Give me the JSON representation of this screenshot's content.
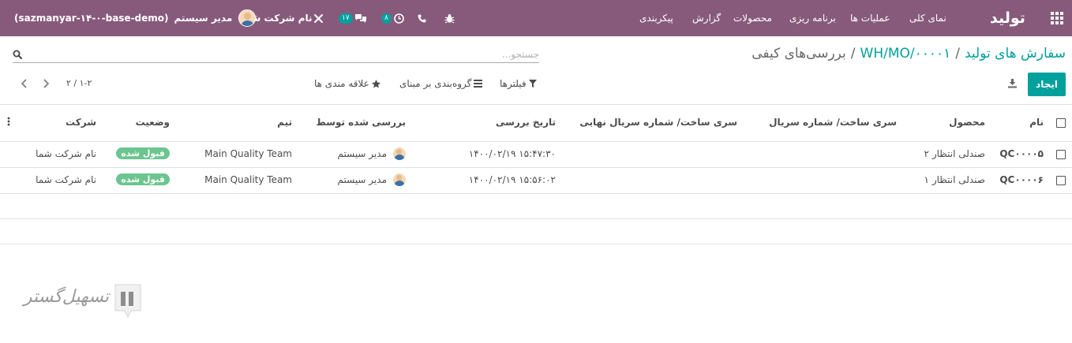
{
  "navbar": {
    "app_name": "تولید",
    "menu": [
      "نمای کلی",
      "عملیات ها",
      "برنامه ریزی",
      "محصولات",
      "گزارش",
      "پیکربندی"
    ],
    "activity_count": "۸",
    "messages_count": "۱۷",
    "company_name": "نام شرکت شما",
    "user_name": "مدیر سیستم",
    "database": "(sazmanyar-۱۴-۰-base-demo)",
    "color": "#875a7b"
  },
  "breadcrumb": {
    "items": [
      "سفارش های تولید",
      "WH/MO/۰۰۰۰۱"
    ],
    "active": "بررسی‌های کیفی"
  },
  "search": {
    "placeholder": "جستجو...",
    "value": ""
  },
  "toolbar": {
    "create_label": "ایجاد",
    "filters_label": "فیلترها",
    "group_by_label": "گروه‌بندی بر مبنای",
    "favorites_label": "علاقه مندی ها",
    "pager_value": "۱-۲",
    "pager_total": "۲",
    "accent_color": "#00a09d"
  },
  "table": {
    "headers": {
      "name": "نام",
      "product": "محصول",
      "lot_serial": "سری ساخت/ شماره سریال",
      "final_lot_serial": "سری ساخت/ شماره سریال نهایی",
      "check_date": "تاریخ بررسی",
      "checked_by": "بررسی شده توسط",
      "team": "تیم",
      "status": "وضعیت",
      "company": "شرکت"
    },
    "rows": [
      {
        "name": "QC۰۰۰۰۵",
        "product": "صندلی انتظار ۲",
        "date": "۱۴۰۰/۰۲/۱۹ ۱۵:۴۷:۳۰",
        "checked_by": "مدیر سیستم",
        "team": "Main Quality Team",
        "status": "قبول شده",
        "company": "نام شرکت شما"
      },
      {
        "name": "QC۰۰۰۰۶",
        "product": "صندلی انتظار ۱",
        "date": "۱۴۰۰/۰۲/۱۹ ۱۵:۵۶:۰۲",
        "checked_by": "مدیر سیستم",
        "team": "Main Quality Team",
        "status": "قبول شده",
        "company": "نام شرکت شما"
      }
    ],
    "status_color": "#6bc58f"
  },
  "watermark": {
    "text": "تسهیل‌گستر",
    "color": "#9a9a9a"
  }
}
